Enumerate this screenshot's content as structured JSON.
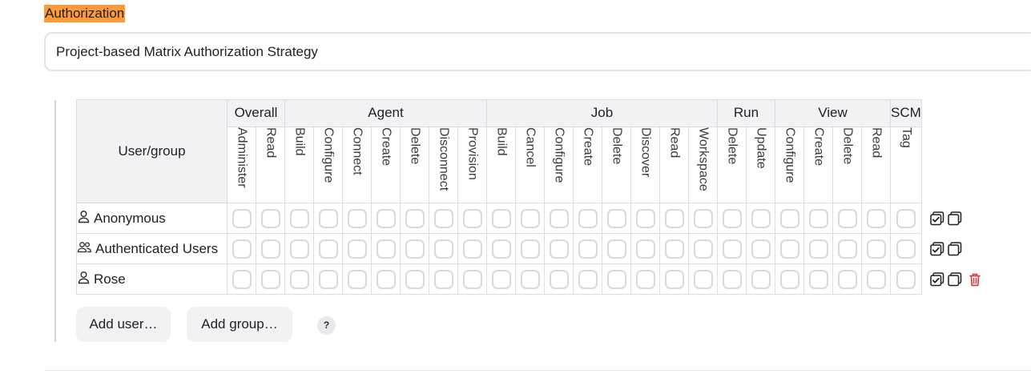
{
  "section": {
    "title": "Authorization"
  },
  "strategy": {
    "value": "Project-based Matrix Authorization Strategy"
  },
  "matrix": {
    "user_group_header": "User/group",
    "groups": [
      {
        "label": "Overall",
        "permissions": [
          "Administer",
          "Read"
        ]
      },
      {
        "label": "Agent",
        "permissions": [
          "Build",
          "Configure",
          "Connect",
          "Create",
          "Delete",
          "Disconnect",
          "Provision"
        ]
      },
      {
        "label": "Job",
        "permissions": [
          "Build",
          "Cancel",
          "Configure",
          "Create",
          "Delete",
          "Discover",
          "Read",
          "Workspace"
        ]
      },
      {
        "label": "Run",
        "permissions": [
          "Delete",
          "Update"
        ]
      },
      {
        "label": "View",
        "permissions": [
          "Configure",
          "Create",
          "Delete",
          "Read"
        ]
      },
      {
        "label": "SCM",
        "permissions": [
          "Tag"
        ]
      }
    ],
    "rows": [
      {
        "name": "Anonymous",
        "icon": "user-icon",
        "deletable": false
      },
      {
        "name": "Authenticated Users",
        "icon": "users-icon",
        "deletable": false
      },
      {
        "name": "Rose",
        "icon": "user-icon",
        "deletable": true
      }
    ]
  },
  "buttons": {
    "add_user": "Add user…",
    "add_group": "Add group…",
    "help": "?"
  },
  "colors": {
    "highlight": "#fe9a3c",
    "delete": "#e0323a",
    "checkbox_border": "#d8d9df"
  }
}
